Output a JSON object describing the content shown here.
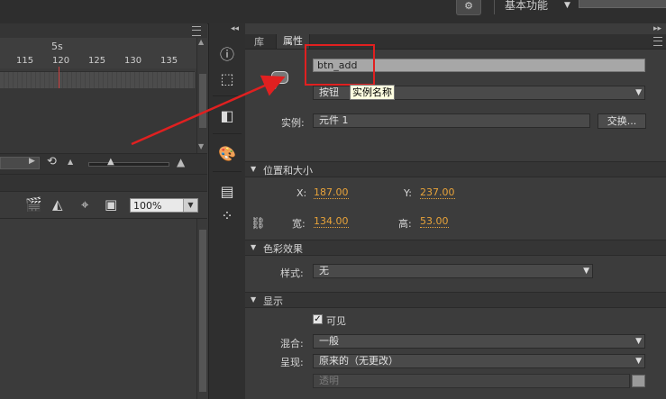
{
  "workspace": {
    "switcher_icon": "gear-icon",
    "label": "基本功能"
  },
  "timeline": {
    "seconds_label": "5s",
    "frame_ticks": [
      "115",
      "120",
      "125",
      "130",
      "135"
    ],
    "zoom_value": "100%"
  },
  "panel_tabs": {
    "library": "库",
    "properties": "属性"
  },
  "properties": {
    "instance_name_value": "btn_add",
    "symbol_type": "按钮",
    "tooltip": "实例名称",
    "instance_of_label": "实例:",
    "instance_of_value": "元件 1",
    "swap_button": "交换..."
  },
  "position_size": {
    "header": "位置和大小",
    "x_label": "X:",
    "x_value": "187.00",
    "y_label": "Y:",
    "y_value": "237.00",
    "width_label": "宽:",
    "width_value": "134.00",
    "height_label": "高:",
    "height_value": "53.00"
  },
  "color_effect": {
    "header": "色彩效果",
    "style_label": "样式:",
    "style_value": "无"
  },
  "display": {
    "header": "显示",
    "visible_label": "可见",
    "blend_label": "混合:",
    "blend_value": "一般",
    "render_label": "呈现:",
    "render_value": "原来的（无更改）",
    "transparent_label": "透明"
  },
  "colors": {
    "accent_value": "#e8a33a",
    "annotation_red": "#e02020"
  }
}
